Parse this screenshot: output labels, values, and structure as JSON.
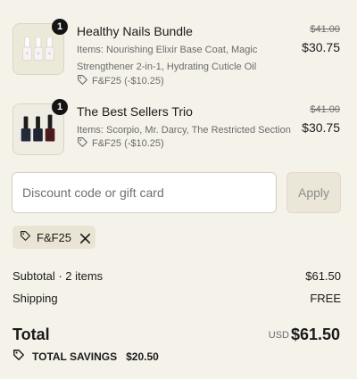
{
  "cart": {
    "items": [
      {
        "quantity": "1",
        "name": "Healthy Nails Bundle",
        "description": "Items: Nourishing Elixir Base Coat, Magic Strengthener 2-in-1, Hydrating Cuticle Oil",
        "discount_label": "F&F25 (-$10.25)",
        "original_price": "$41.00",
        "price": "$30.75"
      },
      {
        "quantity": "1",
        "name": "The Best Sellers Trio",
        "description": "Items: Scorpio, Mr. Darcy, The Restricted Section",
        "discount_label": "F&F25 (-$10.25)",
        "original_price": "$41.00",
        "price": "$30.75"
      }
    ]
  },
  "discount": {
    "placeholder": "Discount code or gift card",
    "apply_label": "Apply",
    "applied_code": "F&F25"
  },
  "summary": {
    "subtotal_label": "Subtotal · 2 items",
    "subtotal_value": "$61.50",
    "shipping_label": "Shipping",
    "shipping_value": "FREE",
    "total_label": "Total",
    "currency": "USD",
    "total_value": "$61.50",
    "savings_label": "TOTAL SAVINGS",
    "savings_value": "$20.50"
  },
  "icons": {
    "tag": "tag-icon",
    "close": "close-icon"
  },
  "colors": {
    "background": "#f5f2ea",
    "badge": "#141414",
    "chip": "#e9e4d3",
    "muted_text": "#6b6b6b"
  }
}
